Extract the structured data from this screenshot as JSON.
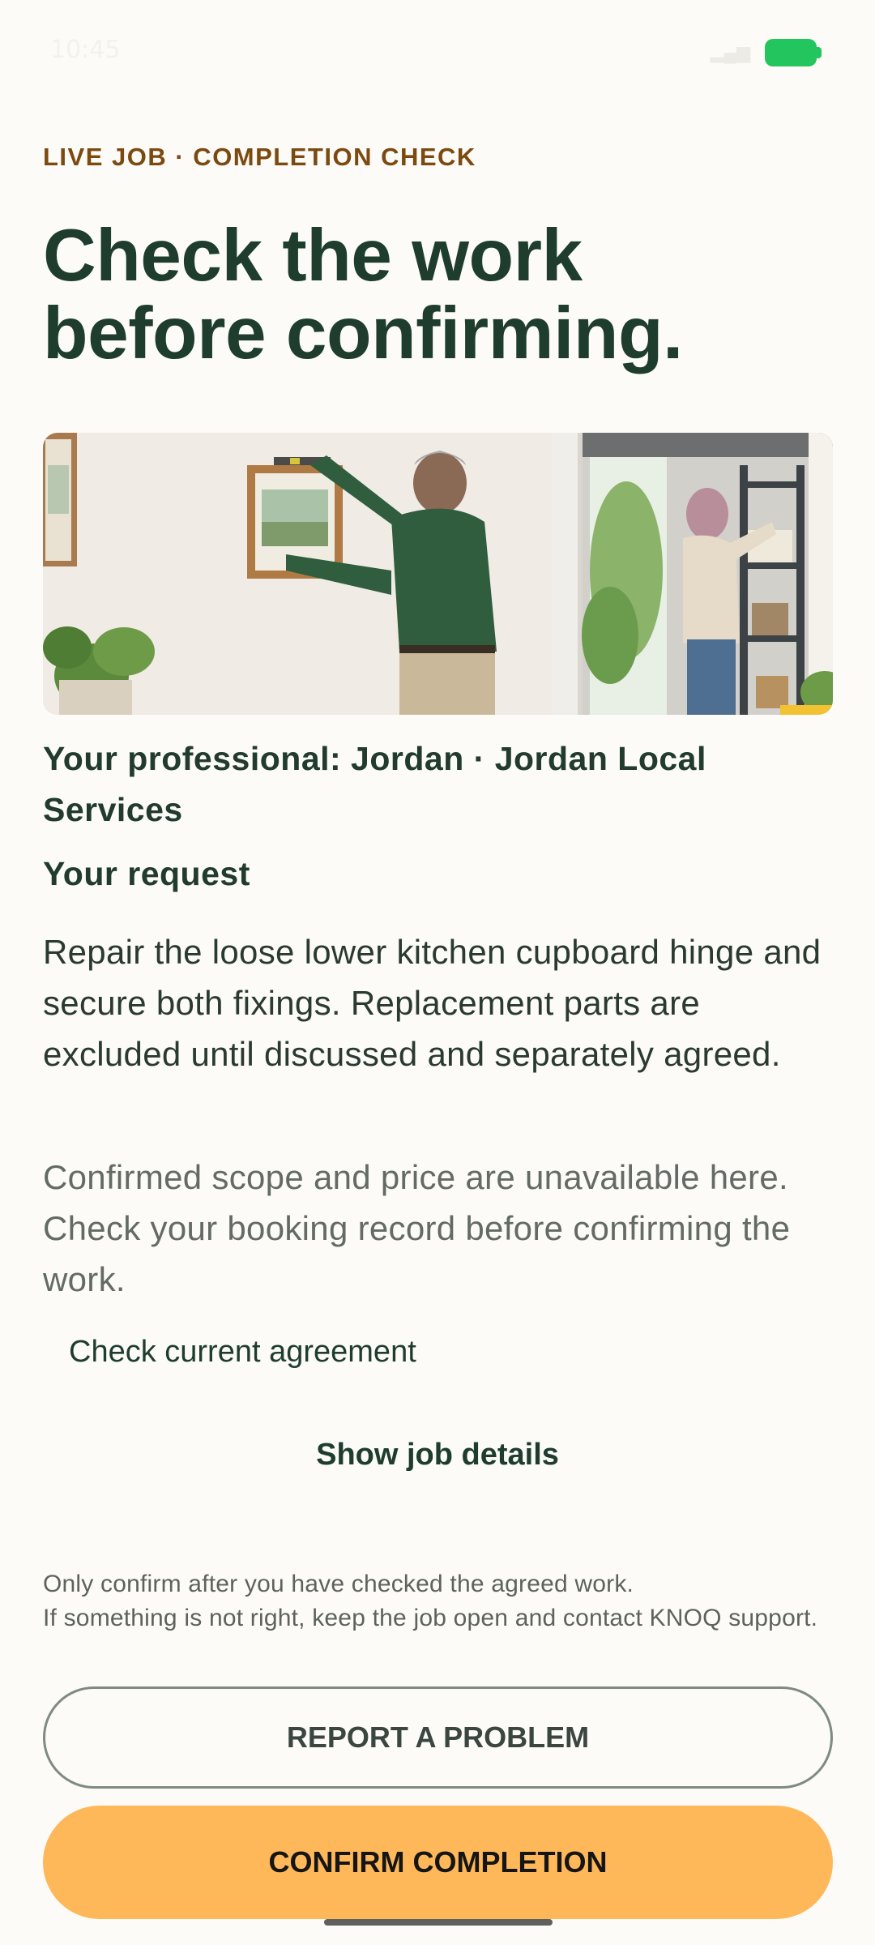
{
  "status_bar": {
    "time": "10:45",
    "signal_icon": "signal-icon",
    "battery_icon": "battery-icon",
    "battery_color": "#22c55e"
  },
  "eyebrow": "LIVE JOB · COMPLETION CHECK",
  "headline": {
    "line1": "Check the work",
    "line2": "before confirming."
  },
  "photo": {
    "icon": "job-photo"
  },
  "professional_line": "Your professional: Jordan · Jordan Local Services",
  "request": {
    "title": "Your request",
    "body": "Repair the loose lower kitchen cupboard hinge and secure both fixings. Replacement parts are excluded until discussed and separately agreed."
  },
  "scope_note": "Confirmed scope and price are unavailable here. Check your booking record before confirming the work.",
  "agreement_link": "Check current agreement",
  "details_toggle": "Show job details",
  "footer_note": {
    "line1": "Only confirm after you have checked the agreed work.",
    "line2": "If something is not right, keep the job open and contact KNOQ support."
  },
  "buttons": {
    "report": "REPORT A PROBLEM",
    "confirm": "CONFIRM COMPLETION"
  },
  "colors": {
    "accent": "#ffb859",
    "heading": "#1f3d2c",
    "eyebrow": "#7a4a10",
    "background": "#fcfbf7"
  }
}
